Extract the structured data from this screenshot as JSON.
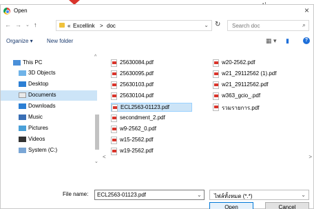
{
  "window": {
    "title": "Open"
  },
  "address": {
    "crumbs": [
      "Excellink",
      "doc"
    ],
    "separators": [
      "«",
      ">"
    ],
    "search_placeholder": "Search doc"
  },
  "toolbar": {
    "organize_label": "Organize ▾",
    "new_folder_label": "New folder"
  },
  "sidebar": {
    "items": [
      {
        "label": "This PC",
        "icon": "computer-icon",
        "indent": 1
      },
      {
        "label": "3D Objects",
        "icon": "cube-icon",
        "indent": 2
      },
      {
        "label": "Desktop",
        "icon": "desktop-icon",
        "indent": 2
      },
      {
        "label": "Documents",
        "icon": "documents-icon",
        "indent": 2,
        "selected": true
      },
      {
        "label": "Downloads",
        "icon": "download-icon",
        "indent": 2
      },
      {
        "label": "Music",
        "icon": "music-icon",
        "indent": 2
      },
      {
        "label": "Pictures",
        "icon": "pictures-icon",
        "indent": 2
      },
      {
        "label": "Videos",
        "icon": "video-icon",
        "indent": 2
      },
      {
        "label": "System (C:)",
        "icon": "drive-icon",
        "indent": 2
      }
    ]
  },
  "files": {
    "col1": [
      "25630084.pdf",
      "25630095.pdf",
      "25630103.pdf",
      "25630104.pdf",
      "ECL2563-01123.pdf",
      "secondment_2.pdf",
      "w9-2562_0.pdf",
      "w15-2562.pdf",
      "w19-2562.pdf"
    ],
    "col2": [
      "w20-2562.pdf",
      "w21_29112562 (1).pdf",
      "w21_29112562.pdf",
      "w363_gcio_.pdf",
      "รวมรายการ.pdf"
    ],
    "selected": "ECL2563-01123.pdf"
  },
  "bottom": {
    "file_name_label": "File name:",
    "file_name_value": "ECL2563-01123.pdf",
    "file_type_label": "ไฟล์ทั้งหมด (*.*)",
    "open_label": "Open",
    "cancel_label": "Cancel"
  },
  "colors": {
    "selection": "#cce4f7",
    "accent_blue": "#0078d7",
    "pdf_red": "#d9342b"
  }
}
